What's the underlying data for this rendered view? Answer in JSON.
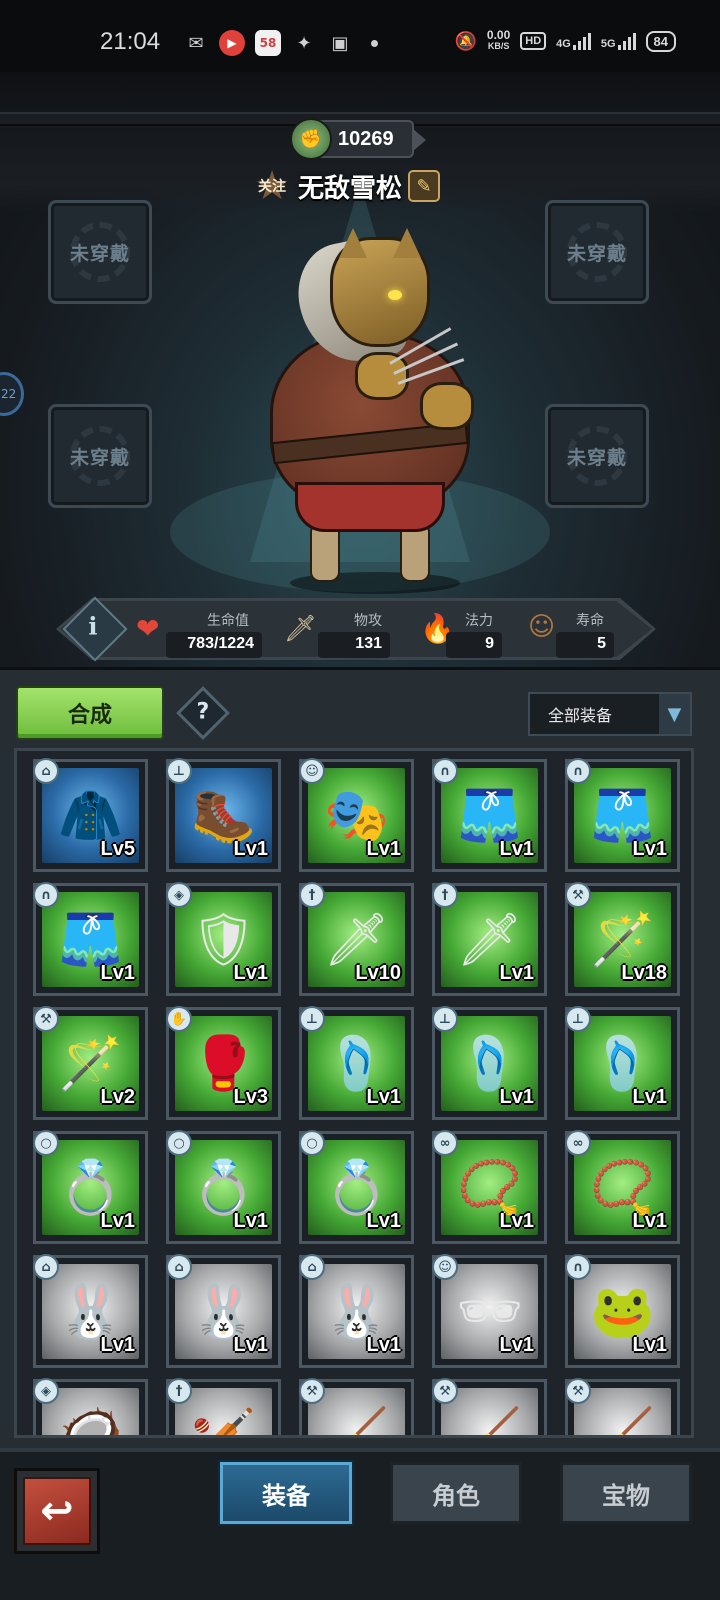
{
  "status_bar": {
    "time": "21:04",
    "net_speed_value": "0.00",
    "net_speed_unit": "KB/S",
    "hd_label": "HD",
    "sig1": "4G",
    "sig2": "5G",
    "battery": "84"
  },
  "scene": {
    "score": "10269",
    "follow_label": "关注",
    "player_name": "无敌雪松",
    "side_tab_label": "22",
    "slots": [
      "未穿戴",
      "未穿戴",
      "未穿戴",
      "未穿戴"
    ],
    "skills": [
      "bat-demon-icon",
      "fist-icon",
      "arm-flex-icon",
      "card-icon",
      "fall-icon"
    ]
  },
  "stats": {
    "hp_label": "生命值",
    "hp_value": "783/1224",
    "atk_label": "物攻",
    "atk_value": "131",
    "magic_label": "法力",
    "magic_value": "9",
    "life_label": "寿命",
    "life_value": "5"
  },
  "inventory": {
    "compose_label": "合成",
    "help_label": "?",
    "filter_value": "全部装备",
    "items": [
      {
        "bg": "blue",
        "icon": "hood-icon",
        "glyph": "🧥",
        "level": "Lv5",
        "type": "hat"
      },
      {
        "bg": "blue",
        "icon": "boots-icon",
        "glyph": "🥾",
        "level": "Lv1",
        "type": "boot"
      },
      {
        "bg": "green",
        "icon": "mask-icon",
        "glyph": "🎭",
        "level": "Lv1",
        "type": "face"
      },
      {
        "bg": "green",
        "icon": "pants-icon",
        "glyph": "🩳",
        "level": "Lv1",
        "type": "pants"
      },
      {
        "bg": "green",
        "icon": "pants-icon",
        "glyph": "🩳",
        "level": "Lv1",
        "type": "pants"
      },
      {
        "bg": "green",
        "icon": "pants-icon",
        "glyph": "🩳",
        "level": "Lv1",
        "type": "pants"
      },
      {
        "bg": "green",
        "icon": "shield-icon",
        "glyph": "🛡",
        "level": "Lv1",
        "type": "shield"
      },
      {
        "bg": "green",
        "icon": "sword-icon",
        "glyph": "🗡",
        "level": "Lv10",
        "type": "sword"
      },
      {
        "bg": "green",
        "icon": "sword-icon",
        "glyph": "🗡",
        "level": "Lv1",
        "type": "sword"
      },
      {
        "bg": "green",
        "icon": "staff-icon",
        "glyph": "🪄",
        "level": "Lv18",
        "type": "staff"
      },
      {
        "bg": "green",
        "icon": "staff-icon",
        "glyph": "🪄",
        "level": "Lv2",
        "type": "staff"
      },
      {
        "bg": "green",
        "icon": "gloves-icon",
        "glyph": "🥊",
        "level": "Lv3",
        "type": "glove"
      },
      {
        "bg": "green",
        "icon": "sandals-icon",
        "glyph": "🩴",
        "level": "Lv1",
        "type": "boot"
      },
      {
        "bg": "green",
        "icon": "sandals-icon",
        "glyph": "🩴",
        "level": "Lv1",
        "type": "boot"
      },
      {
        "bg": "green",
        "icon": "sandals-icon",
        "glyph": "🩴",
        "level": "Lv1",
        "type": "boot"
      },
      {
        "bg": "green",
        "icon": "ring-icon",
        "glyph": "💍",
        "level": "Lv1",
        "type": "ring"
      },
      {
        "bg": "green",
        "icon": "ring-icon",
        "glyph": "💍",
        "level": "Lv1",
        "type": "ring"
      },
      {
        "bg": "green",
        "icon": "ring-icon",
        "glyph": "💍",
        "level": "Lv1",
        "type": "ring"
      },
      {
        "bg": "green",
        "icon": "necklace-icon",
        "glyph": "📿",
        "level": "Lv1",
        "type": "neck"
      },
      {
        "bg": "green",
        "icon": "necklace-icon",
        "glyph": "📿",
        "level": "Lv1",
        "type": "neck"
      },
      {
        "bg": "gray",
        "icon": "bunny-hood-icon",
        "glyph": "🐰",
        "level": "Lv1",
        "type": "hat"
      },
      {
        "bg": "gray",
        "icon": "bunny-hood-icon",
        "glyph": "🐰",
        "level": "Lv1",
        "type": "hat"
      },
      {
        "bg": "gray",
        "icon": "bunny-hood-icon",
        "glyph": "🐰",
        "level": "Lv1",
        "type": "hat"
      },
      {
        "bg": "gray",
        "icon": "sunglasses-icon",
        "glyph": "🕶",
        "level": "Lv1",
        "type": "face"
      },
      {
        "bg": "gray",
        "icon": "frog-pants-icon",
        "glyph": "🐸",
        "level": "Lv1",
        "type": "pants"
      },
      {
        "bg": "gray",
        "icon": "round-shield-icon",
        "glyph": "🥥",
        "level": "",
        "type": "shield"
      },
      {
        "bg": "gray",
        "icon": "wooden-sword-icon",
        "glyph": "🏏",
        "level": "",
        "type": "sword"
      },
      {
        "bg": "gray",
        "icon": "mop-icon",
        "glyph": "🧹",
        "level": "",
        "type": "staff"
      },
      {
        "bg": "gray",
        "icon": "mop-icon",
        "glyph": "🧹",
        "level": "",
        "type": "staff"
      },
      {
        "bg": "gray",
        "icon": "mop-icon",
        "glyph": "🧹",
        "level": "",
        "type": "staff"
      }
    ]
  },
  "nav": {
    "equip": "装备",
    "role": "角色",
    "treasure": "宝物"
  },
  "colors": {
    "compose_green": "#8fd35a",
    "nav_active": "#2d6a92"
  }
}
